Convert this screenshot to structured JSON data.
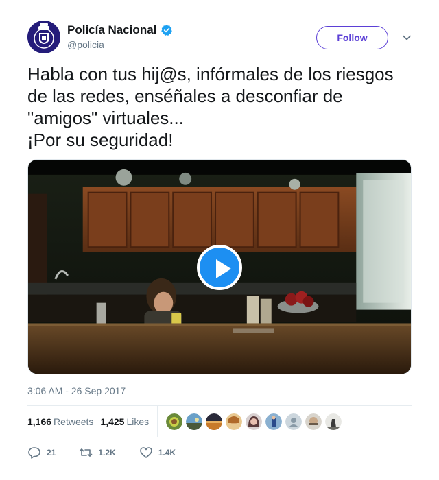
{
  "account": {
    "display_name": "Policía Nacional",
    "screen_name": "@policia",
    "verified_icon": "verified-badge-icon"
  },
  "header": {
    "follow_label": "Follow"
  },
  "tweet": {
    "text": "Habla con tus hij@s, infórmales de los riesgos de las redes, enséñales a desconfiar de \"amigos\" virtuales...\n¡Por su seguridad!",
    "timestamp": "3:06 AM - 26 Sep 2017"
  },
  "stats": {
    "retweets_count": "1,166",
    "retweets_label": "Retweets",
    "likes_count": "1,425",
    "likes_label": "Likes"
  },
  "actions": {
    "replies": "21",
    "retweets": "1.2K",
    "likes": "1.4K"
  },
  "colors": {
    "follow_accent": "#5b3fd6",
    "play_button": "#1d8ff2",
    "verified": "#1da1f2",
    "muted_text": "#657786"
  }
}
